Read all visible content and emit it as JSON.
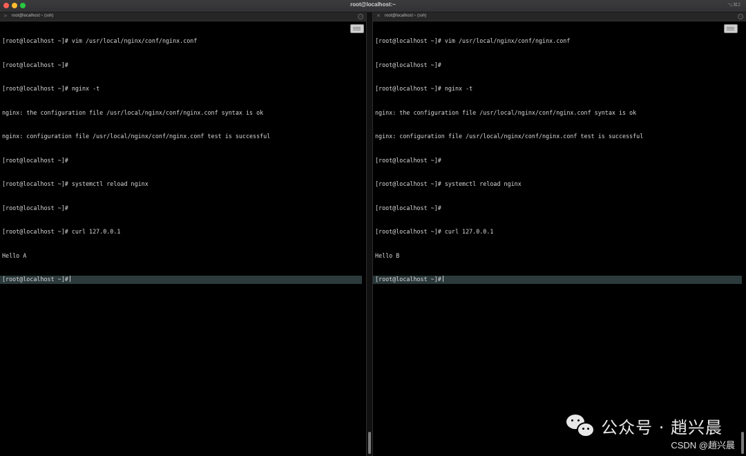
{
  "window": {
    "title": "root@localhost:~",
    "shortcut": "⌥⌘2"
  },
  "left_pane": {
    "tab_label": "root@localhost:~ (ssh)",
    "lines": [
      "[root@localhost ~]# vim /usr/local/nginx/conf/nginx.conf",
      "[root@localhost ~]#",
      "[root@localhost ~]# nginx -t",
      "nginx: the configuration file /usr/local/nginx/conf/nginx.conf syntax is ok",
      "nginx: configuration file /usr/local/nginx/conf/nginx.conf test is successful",
      "[root@localhost ~]#",
      "[root@localhost ~]# systemctl reload nginx",
      "[root@localhost ~]#",
      "[root@localhost ~]# curl 127.0.0.1",
      "Hello A"
    ],
    "prompt": "[root@localhost ~]#"
  },
  "right_pane": {
    "tab_label": "root@localhost:~ (ssh)",
    "lines": [
      "[root@localhost ~]# vim /usr/local/nginx/conf/nginx.conf",
      "[root@localhost ~]#",
      "[root@localhost ~]# nginx -t",
      "nginx: the configuration file /usr/local/nginx/conf/nginx.conf syntax is ok",
      "nginx: configuration file /usr/local/nginx/conf/nginx.conf test is successful",
      "[root@localhost ~]#",
      "[root@localhost ~]# systemctl reload nginx",
      "[root@localhost ~]#",
      "[root@localhost ~]# curl 127.0.0.1",
      "Hello B"
    ],
    "prompt": "[root@localhost ~]#"
  },
  "watermark": {
    "text": "公众号 · 趙兴晨",
    "csdn": "CSDN @趙兴晨"
  },
  "icons": {
    "left_tab": "terminal-chevron-icon",
    "right_tab": "close-x-icon",
    "keyboard": "keyboard-icon",
    "wechat": "wechat-logo-icon"
  },
  "colors": {
    "background": "#000000",
    "text": "#d8d8d8",
    "current_line": "#2c3a3c",
    "close": "#ff5f57",
    "minimize": "#febc2e",
    "zoom": "#28c840"
  }
}
